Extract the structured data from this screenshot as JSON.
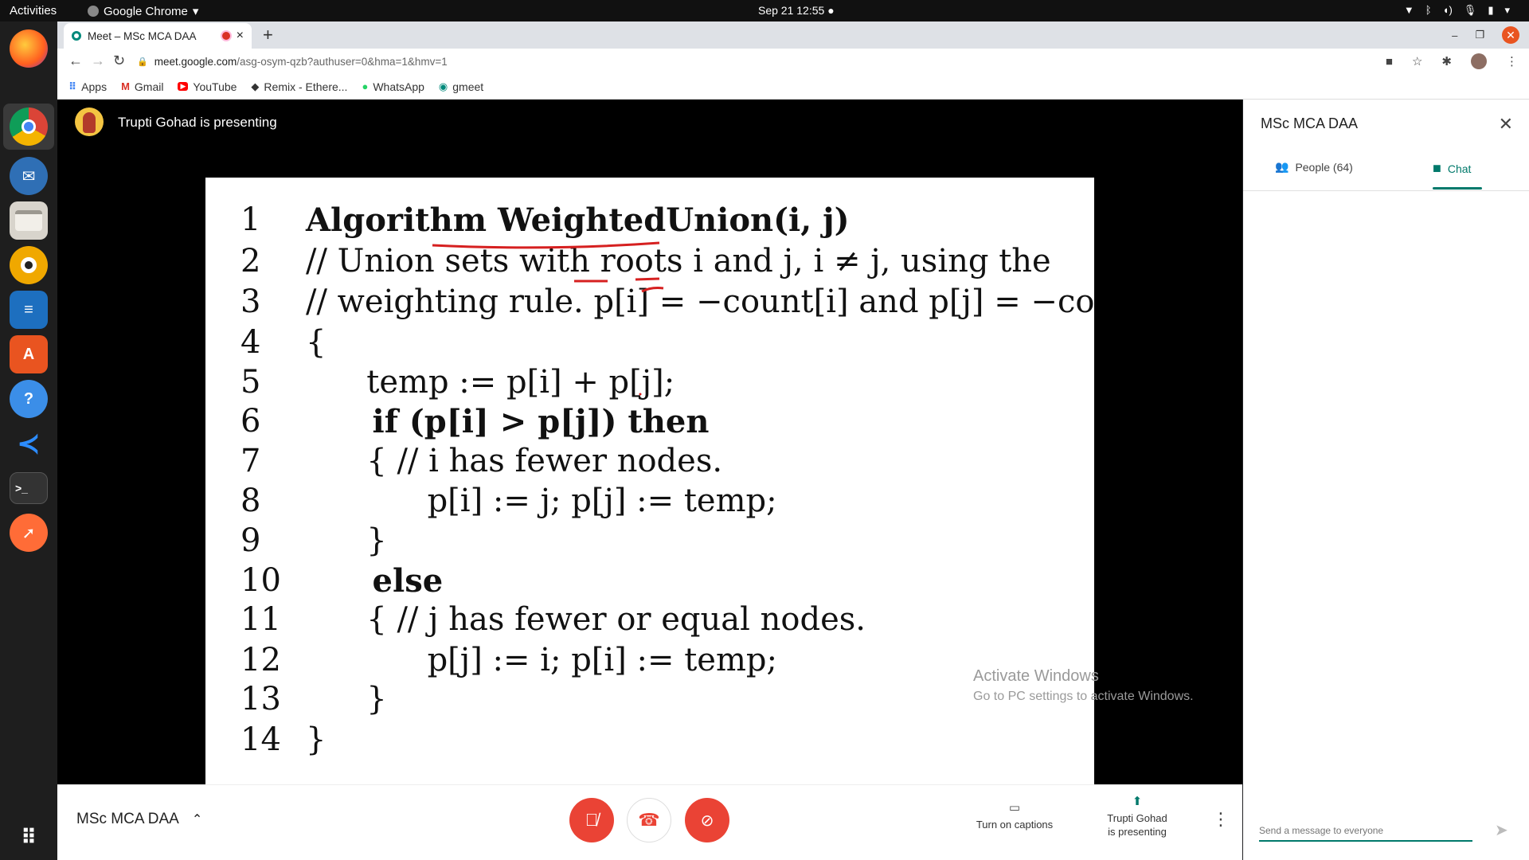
{
  "topbar": {
    "activities": "Activities",
    "app_name": "Google Chrome",
    "clock": "Sep 21  12:55"
  },
  "dock": {
    "items": [
      "Firefox",
      "Chrome",
      "Thunderbird",
      "Files",
      "Rhythmbox",
      "LibreOffice Writer",
      "Ubuntu Software",
      "Help",
      "VS Code",
      "Terminal",
      "Postman"
    ],
    "app_grid_icon": "apps-grid-icon"
  },
  "browser": {
    "tab_title": "Meet – MSc MCA DAA",
    "tab_close": "×",
    "new_tab": "+",
    "url_domain": "meet.google.com",
    "url_path": "/asg-osym-qzb?authuser=0&hma=1&hmv=1",
    "bookmarks": [
      {
        "label": "Apps",
        "icon": "apps-icon"
      },
      {
        "label": "Gmail",
        "icon": "gmail-icon"
      },
      {
        "label": "YouTube",
        "icon": "youtube-icon"
      },
      {
        "label": "Remix - Ethere...",
        "icon": "remix-icon"
      },
      {
        "label": "WhatsApp",
        "icon": "whatsapp-icon"
      },
      {
        "label": "gmeet",
        "icon": "gmeet-icon"
      }
    ]
  },
  "meet": {
    "presenter_text": "Trupti Gohad is presenting",
    "meeting_title": "MSc MCA DAA",
    "captions_label": "Turn on captions",
    "presenting_label_1": "Trupti Gohad",
    "presenting_label_2": "is presenting",
    "watermark_title": "Activate Windows",
    "watermark_sub": "Go to PC settings to activate Windows."
  },
  "slide": {
    "lines": [
      {
        "n": "1",
        "code": "Algorithm WeightedUnion(i, j)"
      },
      {
        "n": "2",
        "code": "// Union sets with roots i and j, i ≠ j, using the"
      },
      {
        "n": "3",
        "code": "// weighting rule. p[i] = −count[i] and p[j] = −count[j]."
      },
      {
        "n": "4",
        "code": "{"
      },
      {
        "n": "5",
        "code": "      temp := p[i] + p[j];"
      },
      {
        "n": "6",
        "code": "      if (p[i] > p[j]) then"
      },
      {
        "n": "7",
        "code": "      { // i has fewer nodes."
      },
      {
        "n": "8",
        "code": "            p[i] := j; p[j] := temp;"
      },
      {
        "n": "9",
        "code": "      }"
      },
      {
        "n": "10",
        "code": "      else"
      },
      {
        "n": "11",
        "code": "      { // j has fewer or equal nodes."
      },
      {
        "n": "12",
        "code": "            p[j] := i; p[i] := temp;"
      },
      {
        "n": "13",
        "code": "      }"
      },
      {
        "n": "14",
        "code": "}"
      }
    ]
  },
  "panel": {
    "title": "MSc MCA DAA",
    "people_tab": "People (64)",
    "chat_tab": "Chat",
    "message_placeholder": "Send a message to everyone"
  },
  "colors": {
    "accent": "#00796b",
    "danger": "#ea4335",
    "ubuntu_orange": "#e95420"
  }
}
